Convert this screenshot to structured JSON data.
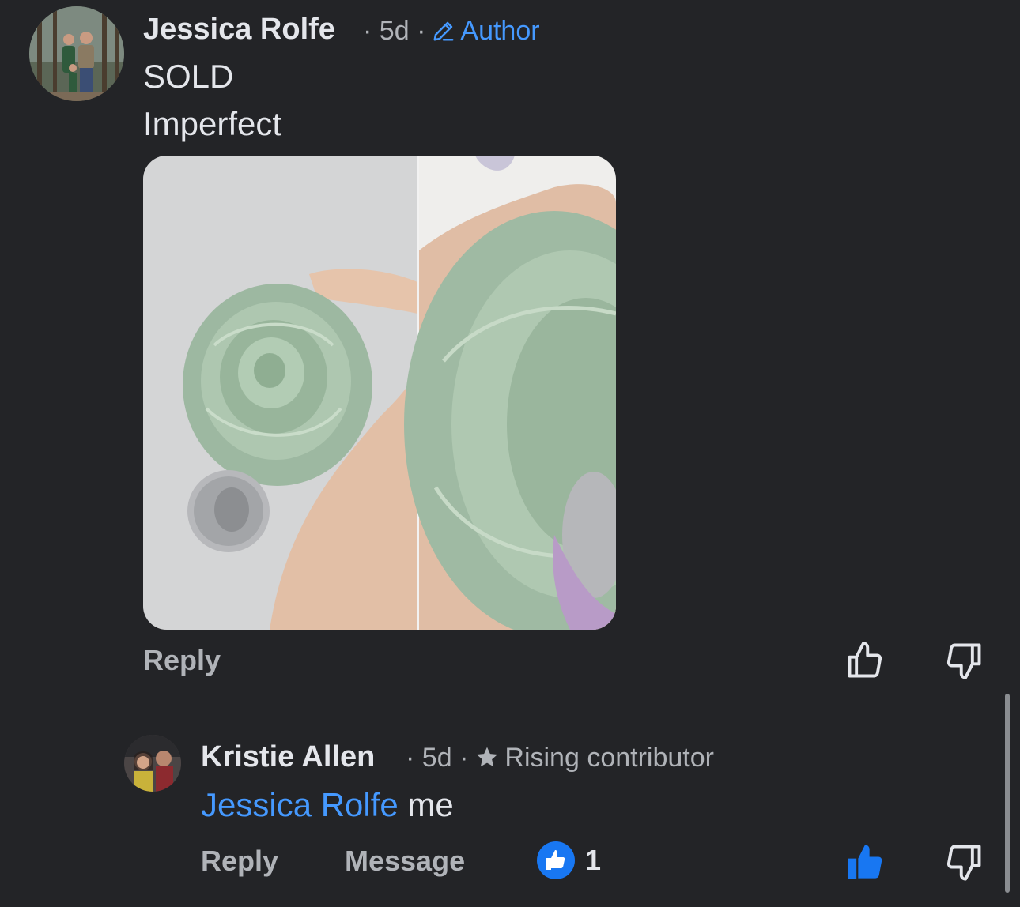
{
  "comment": {
    "author": "Jessica Rolfe",
    "separator": "·",
    "time": "5d",
    "badge": "Author",
    "lines": [
      "SOLD",
      "Imperfect"
    ],
    "photo_alt_icon": "jade-rose-carving-photo",
    "actions": {
      "reply": "Reply"
    }
  },
  "reply": {
    "author": "Kristie Allen",
    "separator": "·",
    "time": "5d",
    "badge": "Rising contributor",
    "mention": "Jessica Rolfe",
    "text": " me",
    "actions": {
      "reply": "Reply",
      "message": "Message"
    },
    "reaction_count": "1"
  },
  "colors": {
    "background": "#232427",
    "accent": "#4599ff",
    "like_active": "#1877f2",
    "muted": "#b0b3b8"
  }
}
